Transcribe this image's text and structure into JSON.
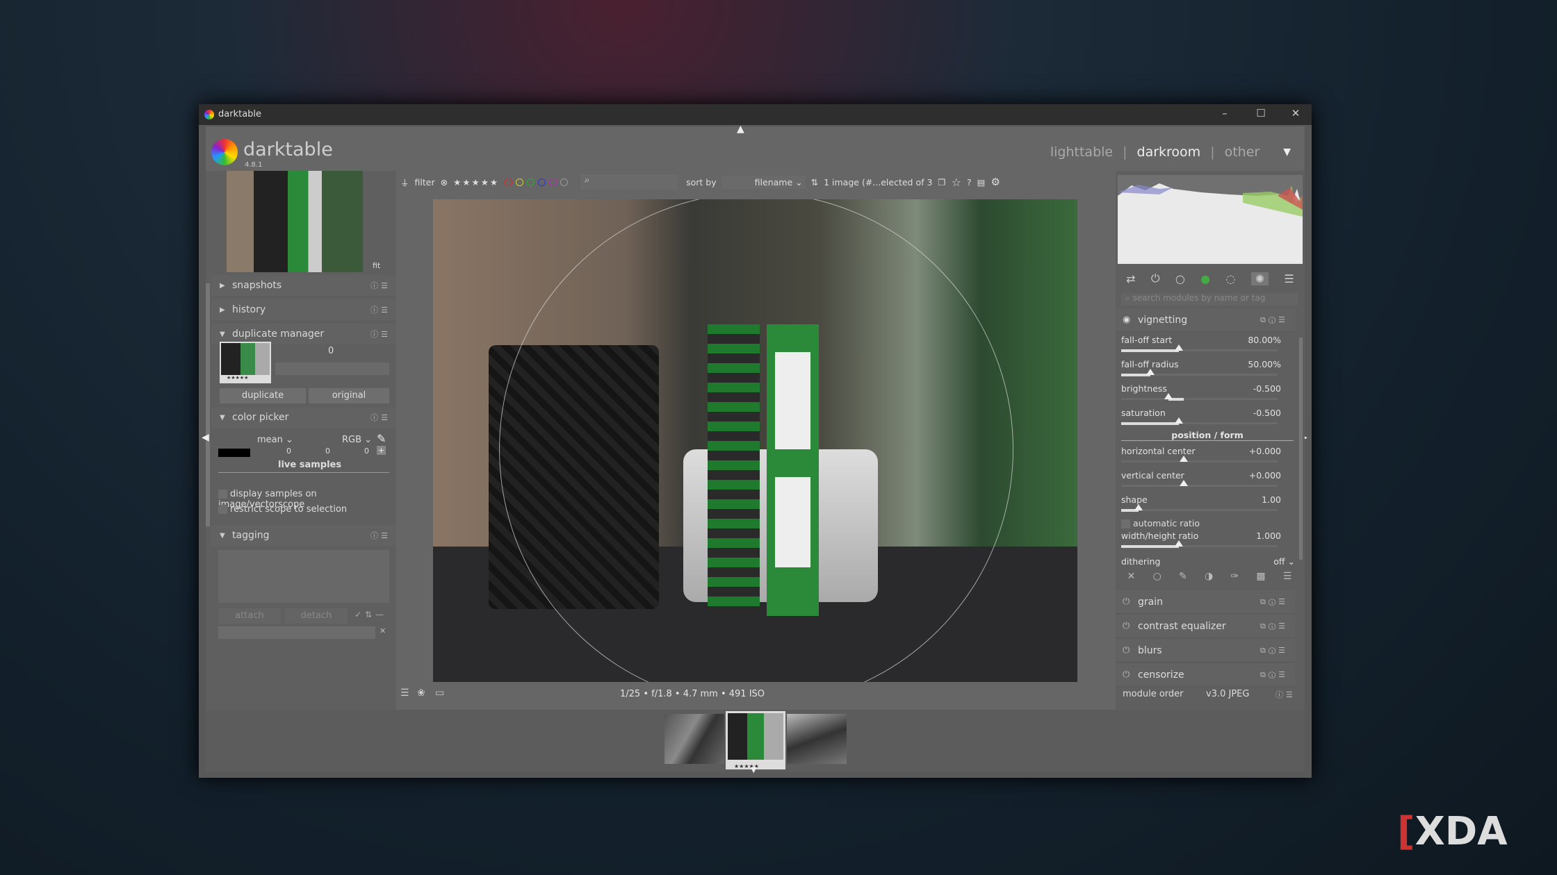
{
  "window": {
    "title": "darktable",
    "min": "–",
    "max": "☐",
    "close": "✕"
  },
  "header": {
    "app_name": "darktable",
    "version": "4.8.1",
    "views": [
      "lighttable",
      "darkroom",
      "other"
    ],
    "active_view": "darkroom",
    "sep": "|"
  },
  "top_toolbar": {
    "filter_label": "filter",
    "stars": "★★★★★",
    "sort_by_label": "sort by",
    "sort_value": "filename",
    "selection_info": "1 image (#...elected of 3",
    "color_labels": [
      "#c33",
      "#cc3",
      "#3a3",
      "#33c",
      "#a3a",
      "#999"
    ]
  },
  "left": {
    "zoom_label": "fit",
    "snapshots": "snapshots",
    "history": "history",
    "duplicate_manager": "duplicate manager",
    "dup_count": "0",
    "dup_stars": "★★★★★",
    "duplicate_btn": "duplicate",
    "original_btn": "original",
    "color_picker": "color picker",
    "mean": "mean",
    "rgb": "RGB",
    "values": [
      "0",
      "0",
      "0"
    ],
    "live_samples": "live samples",
    "display_samples": "display samples on image/vectorscope",
    "restrict_scope": "restrict scope to selection",
    "tagging": "tagging",
    "attach": "attach",
    "detach": "detach"
  },
  "right": {
    "search_placeholder": "search modules by name or tag",
    "vignetting": "vignetting",
    "sliders": [
      {
        "name": "fall-off start",
        "value": "80.00%",
        "level": 0.8
      },
      {
        "name": "fall-off radius",
        "value": "50.00%",
        "level": 0.5
      },
      {
        "name": "brightness",
        "value": "-0.500",
        "level": -0.5
      },
      {
        "name": "saturation",
        "value": "-0.500",
        "level": -0.5
      }
    ],
    "position_form": "position / form",
    "sliders2": [
      {
        "name": "horizontal center",
        "value": "+0.000",
        "level": 0
      },
      {
        "name": "vertical center",
        "value": "+0.000",
        "level": 0
      },
      {
        "name": "shape",
        "value": "1.00",
        "level": 0.25
      }
    ],
    "automatic_ratio": "automatic ratio",
    "wh_ratio": {
      "name": "width/height ratio",
      "value": "1.000",
      "level": 0.6
    },
    "dithering": "dithering",
    "dithering_value": "off",
    "modules": [
      "grain",
      "contrast equalizer",
      "blurs",
      "censorize"
    ],
    "module_order": "module order",
    "module_order_value": "v3.0 JPEG"
  },
  "bottom": {
    "exif": "1/25 • f/1.8 • 4.7 mm • 491 ISO",
    "film_stars": "★★★★★"
  },
  "watermark": "XDA"
}
